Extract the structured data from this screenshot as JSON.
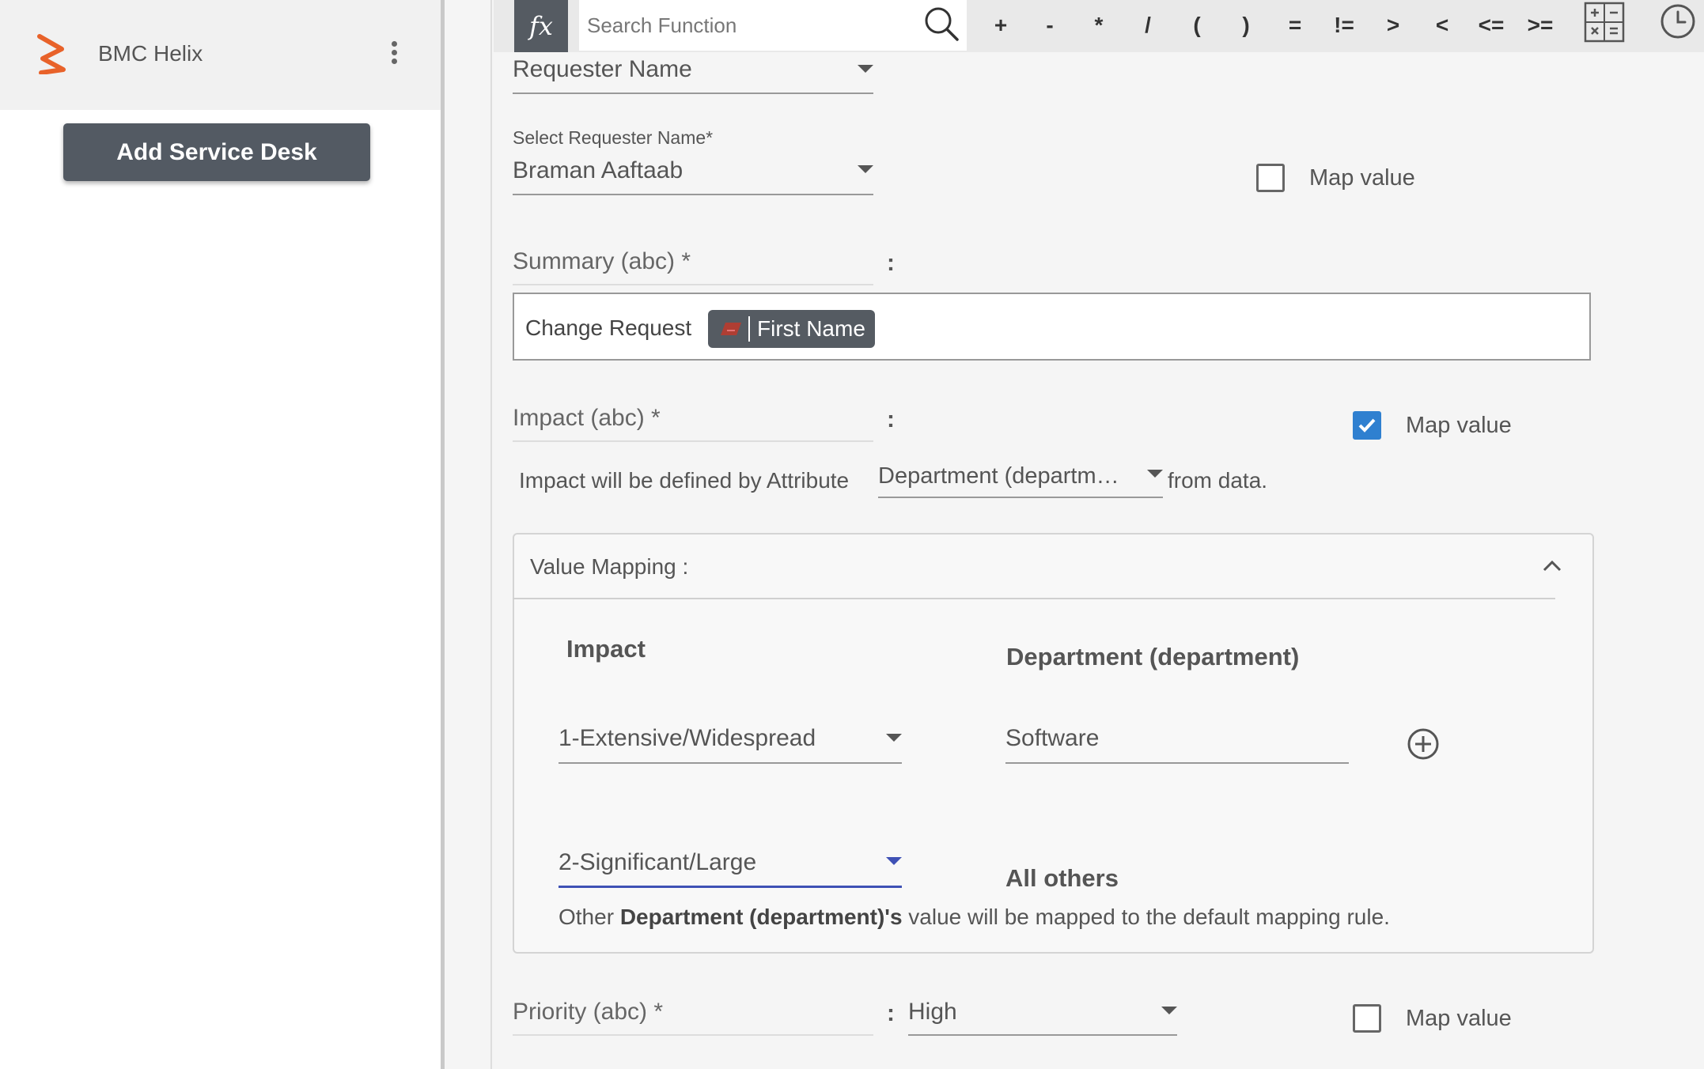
{
  "sidebar": {
    "brand_name": "BMC Helix",
    "add_button_label": "Add Service Desk"
  },
  "toolbar": {
    "fx_label": "fx",
    "search_placeholder": "Search Function",
    "operators": [
      "+",
      "-",
      "*",
      "/",
      "(",
      ")",
      "=",
      "!=",
      ">",
      "<",
      "<=",
      ">="
    ]
  },
  "form": {
    "requester_name_field": "Requester Name",
    "select_requester_label": "Select Requester Name*",
    "select_requester_value": "Braman Aaftaab",
    "map_value_label": "Map value",
    "colon": ":",
    "summary": {
      "label": "Summary (abc) *",
      "text": "Change Request",
      "chip_label": "First Name"
    },
    "impact": {
      "label": "Impact (abc) *",
      "map_value_checked": true,
      "sentence": "Impact will be defined by Attribute",
      "attribute_value": "Department (departm…",
      "sentence_end": "from data."
    },
    "priority": {
      "label": "Priority (abc) *",
      "value": "High",
      "map_value_checked": false
    }
  },
  "value_mapping": {
    "title": "Value Mapping :",
    "col_left": "Impact",
    "col_right": "Department (department)",
    "rows": [
      {
        "impact": "1-Extensive/Widespread",
        "department": "Software"
      },
      {
        "impact": "2-Significant/Large",
        "department": "All others"
      }
    ],
    "note_prefix": "Other ",
    "note_bold": "Department (department)'s",
    "note_suffix": " value will be mapped to the default mapping rule."
  },
  "colors": {
    "brand_orange": "#e8622a",
    "checkbox_blue": "#2f80d0",
    "focus_underline": "#3f51b5",
    "dark_button": "#535a63"
  }
}
